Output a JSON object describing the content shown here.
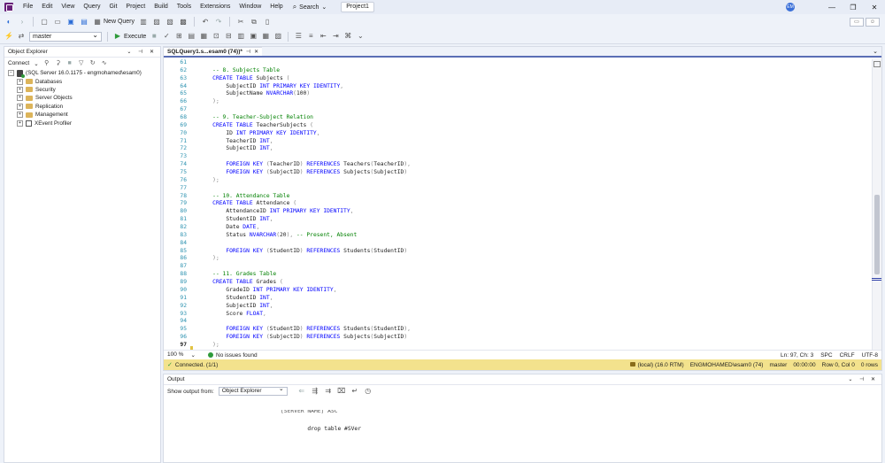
{
  "menu": [
    "File",
    "Edit",
    "View",
    "Query",
    "Git",
    "Project",
    "Build",
    "Tools",
    "Extensions",
    "Window",
    "Help"
  ],
  "search_label": "Search",
  "project_badge": "Project1",
  "avatar_initials": "EM",
  "toolbar": {
    "new_query": "New Query",
    "database": "master",
    "execute": "Execute"
  },
  "object_explorer": {
    "title": "Object Explorer",
    "connect": "Connect",
    "server": "(SQL Server 16.0.1175 - engmohamed\\esam0)",
    "items": [
      "Databases",
      "Security",
      "Server Objects",
      "Replication",
      "Management",
      "XEvent Profiler"
    ]
  },
  "editor": {
    "tab_title": "SQLQuery1.s...esam0 (74))*",
    "current_line": "97",
    "line_numbers": [
      "61",
      "62",
      "63",
      "64",
      "65",
      "66",
      "67",
      "68",
      "69",
      "70",
      "71",
      "72",
      "73",
      "74",
      "75",
      "76",
      "77",
      "78",
      "79",
      "80",
      "81",
      "82",
      "83",
      "84",
      "85",
      "86",
      "87",
      "88",
      "89",
      "90",
      "91",
      "92",
      "93",
      "94",
      "95",
      "96",
      "97"
    ],
    "code": [
      "",
      "    -- 8. Subjects Table",
      "    CREATE TABLE Subjects (",
      "        SubjectID INT PRIMARY KEY IDENTITY,",
      "        SubjectName NVARCHAR(100)",
      "    );",
      "",
      "    -- 9. Teacher-Subject Relation",
      "    CREATE TABLE TeacherSubjects (",
      "        ID INT PRIMARY KEY IDENTITY,",
      "        TeacherID INT,",
      "        SubjectID INT,",
      "",
      "        FOREIGN KEY (TeacherID) REFERENCES Teachers(TeacherID),",
      "        FOREIGN KEY (SubjectID) REFERENCES Subjects(SubjectID)",
      "    );",
      "",
      "    -- 10. Attendance Table",
      "    CREATE TABLE Attendance (",
      "        AttendanceID INT PRIMARY KEY IDENTITY,",
      "        StudentID INT,",
      "        Date DATE,",
      "        Status NVARCHAR(20), -- Present, Absent",
      "",
      "        FOREIGN KEY (StudentID) REFERENCES Students(StudentID)",
      "    );",
      "",
      "    -- 11. Grades Table",
      "    CREATE TABLE Grades (",
      "        GradeID INT PRIMARY KEY IDENTITY,",
      "        StudentID INT,",
      "        SubjectID INT,",
      "        Score FLOAT,",
      "",
      "        FOREIGN KEY (StudentID) REFERENCES Students(StudentID),",
      "        FOREIGN KEY (SubjectID) REFERENCES Subjects(SubjectID)",
      "    );"
    ],
    "zoom": "100 %",
    "issues": "No issues found",
    "position": "Ln: 97, Ch: 3",
    "whitespace": "SPC",
    "line_ending": "CRLF",
    "encoding": "UTF-8"
  },
  "connection": {
    "status": "Connected. (1/1)",
    "server": "(local) (16.0 RTM)",
    "user": "ENGMOHAMED\\esam0 (74)",
    "database": "master",
    "elapsed": "00:00:00",
    "cursor": "Row 0, Col 0",
    "rows": "0 rows"
  },
  "output": {
    "title": "Output",
    "show_from_label": "Show output from:",
    "source": "Object Explorer",
    "lines": [
      "[SERVER_NAME] ASC",
      "        drop table #SVer"
    ]
  },
  "colors": {
    "accent": "#5a6eb5",
    "connection_bar": "#f3e28d",
    "keyword": "#0000ff",
    "comment": "#008000"
  }
}
